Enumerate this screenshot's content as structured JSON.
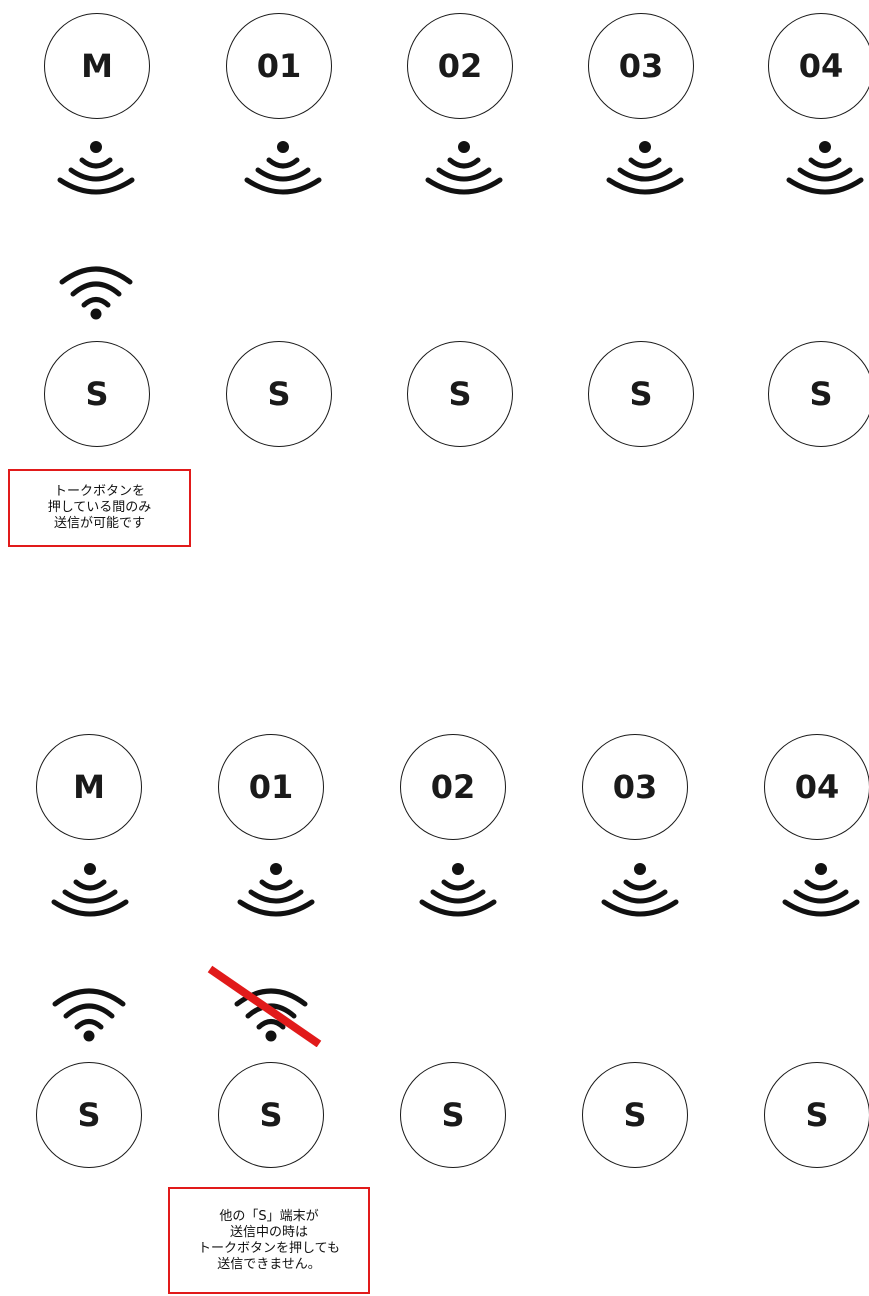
{
  "accent_colors": {
    "stroke": "#1a1a1a",
    "note_border": "#e11a1a",
    "blocked_line": "#e11a1a"
  },
  "panels": [
    {
      "top_nodes": [
        "M",
        "01",
        "02",
        "03",
        "04"
      ],
      "bottom_nodes": [
        "S",
        "S",
        "S",
        "S",
        "S"
      ],
      "receiver_icon": "receiving-signal-icon",
      "sender_icon": "wifi-sending-icon",
      "note": [
        "トークボタンを",
        "押している間のみ",
        "送信が可能です"
      ]
    },
    {
      "top_nodes": [
        "M",
        "01",
        "02",
        "03",
        "04"
      ],
      "bottom_nodes": [
        "S",
        "S",
        "S",
        "S",
        "S"
      ],
      "receiver_icon": "receiving-signal-icon",
      "sender_icon": "wifi-sending-icon",
      "blocked_icon": "wifi-blocked-icon",
      "note": [
        "他の「S」端末が",
        "送信中の時は",
        "トークボタンを押しても",
        "送信できません。"
      ]
    }
  ]
}
